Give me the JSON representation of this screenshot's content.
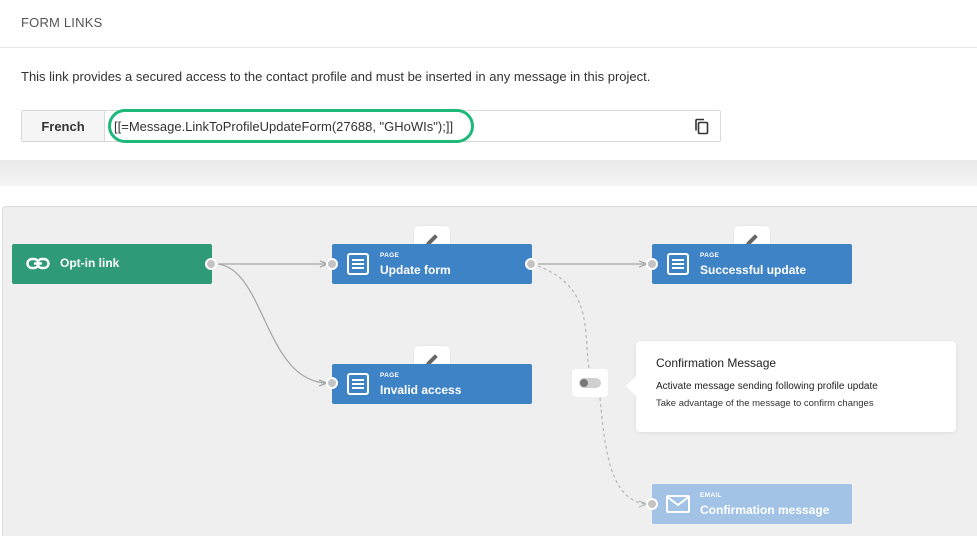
{
  "header": {
    "title": "FORM LINKS"
  },
  "description": "This link provides a secured access to the contact profile and must be inserted in any message in this project.",
  "link": {
    "language": "French",
    "value": "[[=Message.LinkToProfileUpdateForm(27688, \"GHoWIs\");]]"
  },
  "flow": {
    "optin": {
      "label": "Opt-in link"
    },
    "update_form": {
      "kicker": "PAGE",
      "label": "Update form"
    },
    "successful_update": {
      "kicker": "PAGE",
      "label": "Successful update"
    },
    "invalid_access": {
      "kicker": "PAGE",
      "label": "Invalid access"
    },
    "confirmation_email": {
      "kicker": "EMAIL",
      "label": "Confirmation message"
    }
  },
  "confirmation_popup": {
    "title": "Confirmation Message",
    "line1": "Activate message sending following profile update",
    "line2": "Take advantage of the message to confirm changes",
    "enabled": false
  },
  "colors": {
    "accent_green": "#2f9a77",
    "page_blue": "#3f83c7",
    "email_disabled_blue": "#a3c3e6",
    "highlight_ring": "#1db87a"
  }
}
